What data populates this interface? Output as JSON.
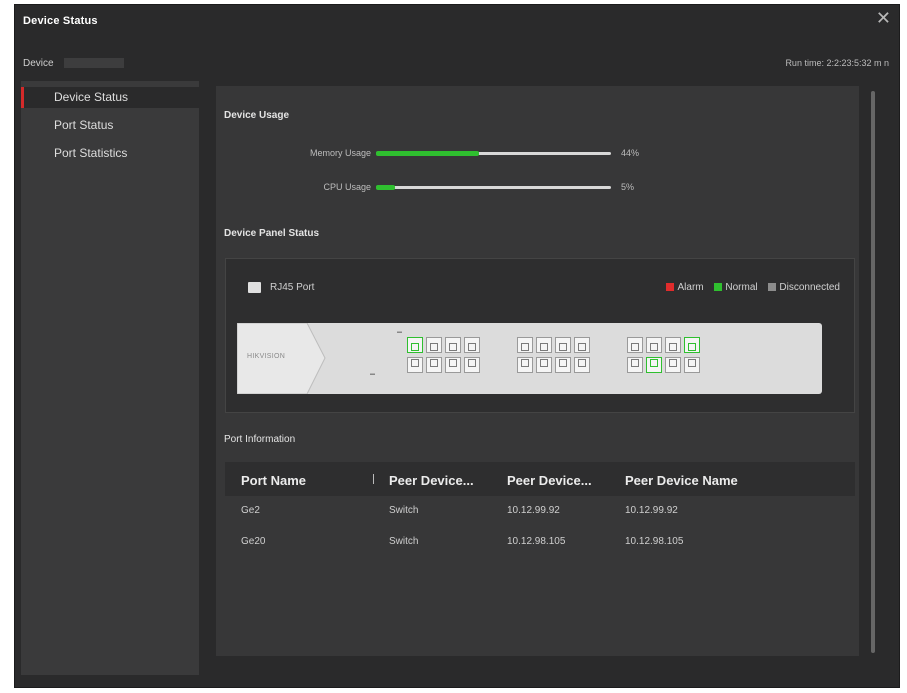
{
  "dialog": {
    "title": "Device Status",
    "device_label": "Device",
    "run_time": "Run time: 2:2:23:5:32 m n"
  },
  "sidebar": {
    "items": [
      {
        "label": "Device Status",
        "active": true
      },
      {
        "label": "Port Status",
        "active": false
      },
      {
        "label": "Port Statistics",
        "active": false
      }
    ]
  },
  "device_usage": {
    "title": "Device Usage",
    "memory": {
      "label": "Memory Usage",
      "value_text": "44%",
      "percent": 44
    },
    "cpu": {
      "label": "CPU Usage",
      "value_text": "5%",
      "percent": 5
    }
  },
  "panel_status": {
    "title": "Device Panel Status",
    "rj45_label": "RJ45 Port",
    "legend": {
      "alarm": "Alarm",
      "normal": "Normal",
      "disconnected": "Disconnected"
    },
    "brand": "HIKVISION",
    "colors": {
      "alarm": "#e02c2c",
      "normal": "#2fbf2f",
      "disconnected": "#8c8c8c"
    }
  },
  "port_info": {
    "title": "Port Information",
    "columns": [
      "Port Name",
      "Peer Device...",
      "Peer Device...",
      "Peer Device Name"
    ],
    "rows": [
      [
        "Ge2",
        "Switch",
        "10.12.99.92",
        "10.12.99.92"
      ],
      [
        "Ge20",
        "Switch",
        "10.12.98.105",
        "10.12.98.105"
      ]
    ]
  }
}
